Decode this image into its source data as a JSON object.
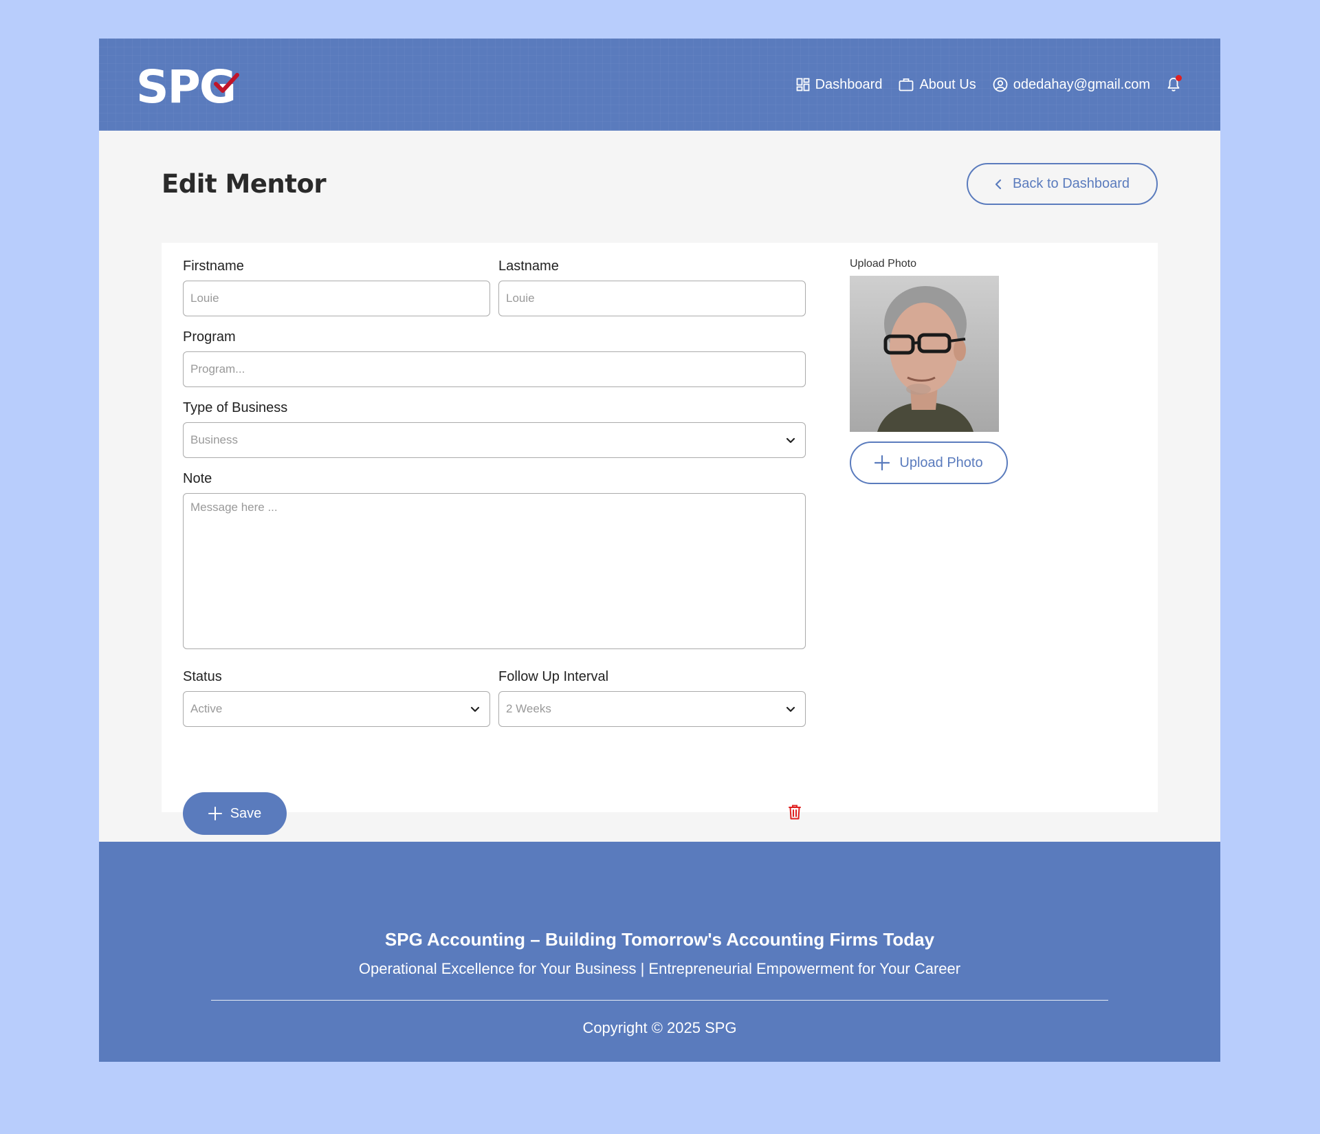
{
  "header": {
    "logo_text": "SPG",
    "nav": {
      "dashboard": "Dashboard",
      "about": "About Us",
      "user_email": "odedahay@gmail.com"
    }
  },
  "page": {
    "title": "Edit Mentor",
    "back_button": "Back to Dashboard"
  },
  "form": {
    "firstname": {
      "label": "Firstname",
      "value": "Louie"
    },
    "lastname": {
      "label": "Lastname",
      "value": "Louie"
    },
    "program": {
      "label": "Program",
      "placeholder": "Program..."
    },
    "business_type": {
      "label": "Type of Business",
      "selected": "Business"
    },
    "note": {
      "label": "Note",
      "placeholder": "Message here ..."
    },
    "status": {
      "label": "Status",
      "selected": "Active"
    },
    "follow_up": {
      "label": "Follow Up Interval",
      "selected": "2 Weeks"
    },
    "save_button": "Save",
    "upload": {
      "label": "Upload Photo",
      "button": "Upload Photo"
    }
  },
  "footer": {
    "title": "SPG Accounting – Building Tomorrow's Accounting Firms Today",
    "subtitle": "Operational Excellence for Your Business | Entrepreneurial Empowerment for Your Career",
    "copyright": "Copyright © 2025 SPG"
  },
  "colors": {
    "primary": "#5a7bbd",
    "background": "#b8cdfc",
    "danger": "#e02020",
    "logo_check": "#c0152a"
  },
  "icons": [
    "dashboard-icon",
    "briefcase-icon",
    "user-circle-icon",
    "bell-icon",
    "chevron-left-icon",
    "chevron-down-icon",
    "plus-icon",
    "trash-icon"
  ]
}
